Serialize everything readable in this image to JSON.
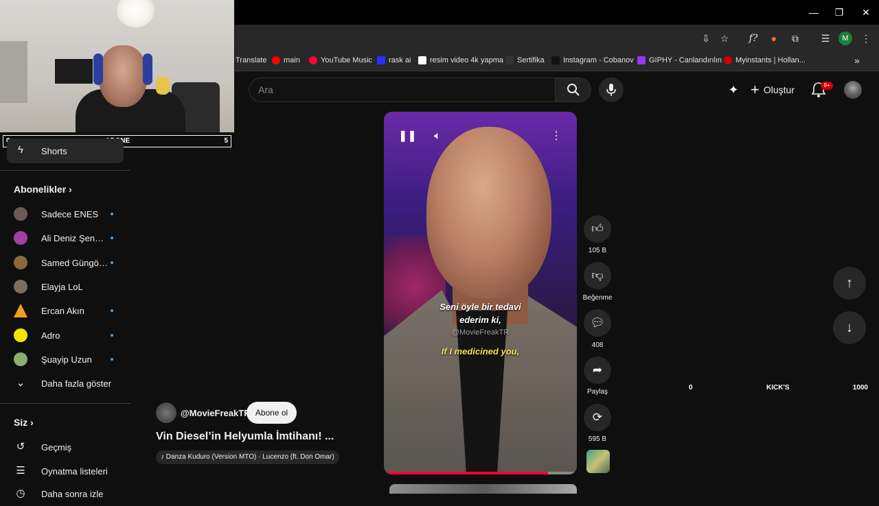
{
  "browser": {
    "window_controls": {
      "minimize": "—",
      "restore": "❐",
      "close": "✕"
    },
    "profile_initial": "M",
    "bookmarks": [
      {
        "label": "Translate",
        "color": "#4285f4"
      },
      {
        "label": "main",
        "color": "#ff0000"
      },
      {
        "label": "YouTube Music",
        "color": "#ff0033"
      },
      {
        "label": "rask ai",
        "color": "#2233ff"
      },
      {
        "label": "resim video 4k yapma",
        "color": "#ffffff"
      },
      {
        "label": "Sertifika",
        "color": "#333333"
      },
      {
        "label": "Instagram - Cobanov",
        "color": "#222222"
      },
      {
        "label": "GIPHY - Canlandırılın",
        "color": "#9933ff"
      },
      {
        "label": "Myinstants | Hollan...",
        "color": "#cc0000"
      }
    ]
  },
  "youtube": {
    "search_placeholder": "Ara",
    "create_label": "Oluştur",
    "notification_count": "9+"
  },
  "overlay": {
    "abone_min": "0",
    "abone_label": "ABONE",
    "abone_max": "5",
    "kick_min": "0",
    "kick_label": "KICK'S",
    "kick_max": "1000"
  },
  "sidebar": {
    "shorts_label": "Shorts",
    "subscriptions_heading": "Abonelikler",
    "subscriptions": [
      {
        "name": "Sadece ENES",
        "new": true,
        "color": "#6b5a55"
      },
      {
        "name": "Ali Deniz Şenpot...",
        "new": true,
        "color": "#a03fa8"
      },
      {
        "name": "Samed Güngör L...",
        "new": true,
        "color": "#8a6a3a"
      },
      {
        "name": "Elayja LoL",
        "new": false,
        "color": "#7a6e60"
      },
      {
        "name": "Ercan Akın",
        "new": true,
        "color": "#f0a020"
      },
      {
        "name": "Adro",
        "new": true,
        "color": "#f2e600"
      },
      {
        "name": "Şuayip Uzun",
        "new": true,
        "color": "#8ab070"
      }
    ],
    "show_more_label": "Daha fazla göster",
    "you_heading": "Siz",
    "history_label": "Geçmiş",
    "playlists_label": "Oynatma listeleri",
    "partial_label": "Daha sonra izle"
  },
  "short": {
    "subtitle_tr_1": "Seni öyle bir tedavi",
    "subtitle_tr_2": "ederim ki,",
    "watermark": "@MovieFreakTR",
    "subtitle_en": "If I medicined you,",
    "progress": 0.85,
    "likes": "105 B",
    "dislike_label": "Beğenme",
    "comments": "408",
    "share_label": "Paylaş",
    "remix_count": "595 B",
    "channel": "@MovieFreakTR",
    "subscribe_label": "Abone ol",
    "title": "Vin Diesel’in Helyumla İmtihanı! ...",
    "music": "Danza Kuduro (Version MTO) · Lucenzo (ft. Don Omar)"
  }
}
